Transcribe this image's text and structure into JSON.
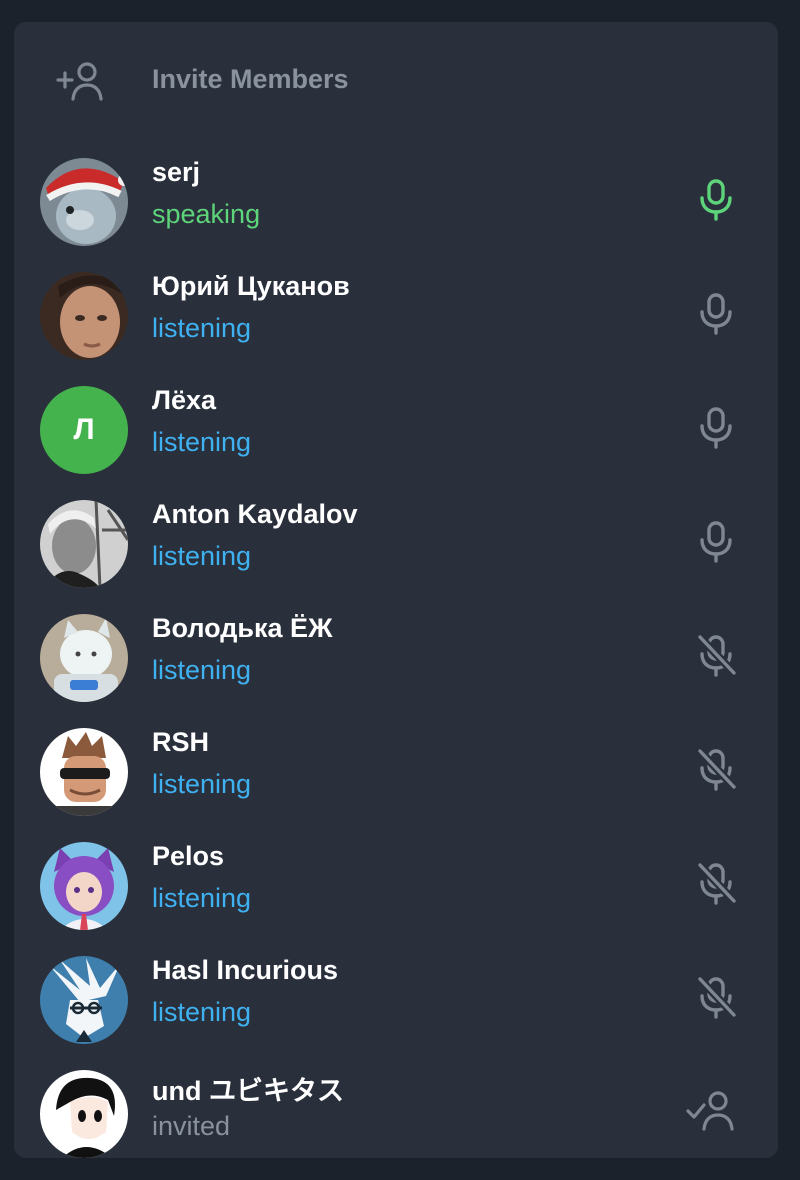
{
  "panel": {
    "invite_label": "Invite Members"
  },
  "colors": {
    "speaking": "#5ed47a",
    "listening": "#3fb1f0",
    "invited": "#8a929d",
    "icon_muted": "#7f8792"
  },
  "members": [
    {
      "name": "serj",
      "status": "speaking",
      "mic": "active-mic-icon"
    },
    {
      "name": "Юрий Цуканов",
      "status": "listening",
      "mic": "mic-icon"
    },
    {
      "name": "Лёха",
      "status": "listening",
      "mic": "mic-icon",
      "initial": "Л"
    },
    {
      "name": "Anton Kaydalov",
      "status": "listening",
      "mic": "mic-icon"
    },
    {
      "name": "Володька ЁЖ",
      "status": "listening",
      "mic": "muted-mic-icon"
    },
    {
      "name": "RSH",
      "status": "listening",
      "mic": "muted-mic-icon"
    },
    {
      "name": "Pelos",
      "status": "listening",
      "mic": "muted-mic-icon"
    },
    {
      "name": "Hasl Incurious",
      "status": "listening",
      "mic": "muted-mic-icon"
    },
    {
      "name": "und ユビキタス",
      "status": "invited",
      "mic": "invited-check-icon"
    }
  ]
}
